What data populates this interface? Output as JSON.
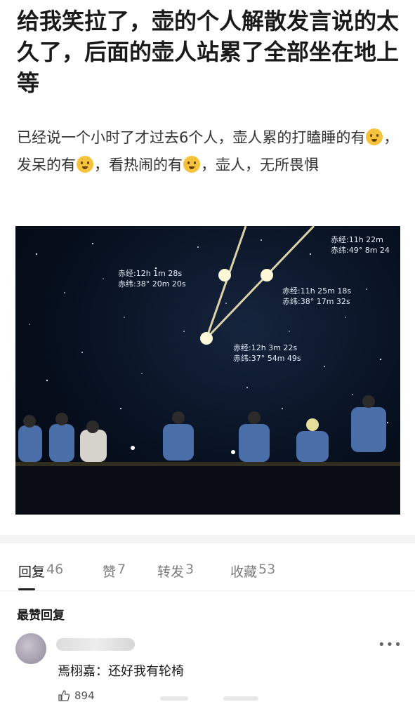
{
  "post": {
    "title": "给我笑拉了，壶的个人解散发言说的太久了，后面的壶人站累了全部坐在地上等",
    "body_part1": "已经说一个小时了才过去6个人，壶人累的打瞌睡的有",
    "body_part2": "，发呆的有",
    "body_part3": "，看热闹的有",
    "body_part4": "，壶人，无所畏惧"
  },
  "photo": {
    "coords": [
      {
        "ra": "赤经:12h 1m 28s",
        "dec": "赤纬:38° 20m 20s"
      },
      {
        "ra": "赤经:11h 25m 18s",
        "dec": "赤纬:38° 17m 32s"
      },
      {
        "ra": "赤经:12h 3m 22s",
        "dec": "赤纬:37° 54m 49s"
      },
      {
        "ra": "赤经:11h 22m",
        "dec": "赤纬:49° 8m 24"
      }
    ]
  },
  "tabs": [
    {
      "label": "回复",
      "count": "46",
      "active": true
    },
    {
      "label": "赞",
      "count": "7",
      "active": false
    },
    {
      "label": "转发",
      "count": "3",
      "active": false
    },
    {
      "label": "收藏",
      "count": "53",
      "active": false
    }
  ],
  "comments_section": {
    "title": "最赞回复"
  },
  "comment": {
    "author": "焉栩嘉",
    "separator": "：",
    "text": "还好我有轮椅",
    "likes": "894",
    "more": "•••"
  },
  "colors": {
    "text": "#1a1a1a",
    "secondary": "#7a7a7a",
    "photo_bg": "#07101f"
  }
}
